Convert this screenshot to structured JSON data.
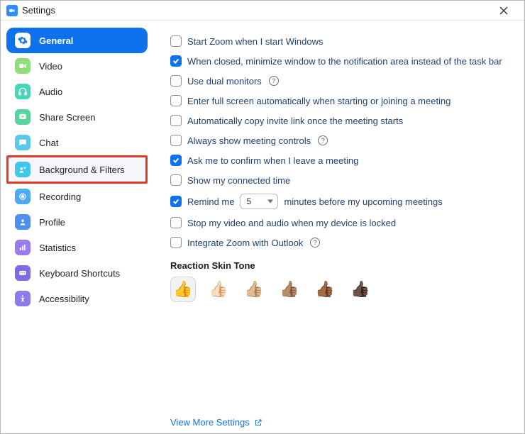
{
  "window": {
    "title": "Settings"
  },
  "sidebar": {
    "items": [
      {
        "id": "general",
        "label": "General",
        "active": true,
        "highlighted": false
      },
      {
        "id": "video",
        "label": "Video",
        "active": false,
        "highlighted": false
      },
      {
        "id": "audio",
        "label": "Audio",
        "active": false,
        "highlighted": false
      },
      {
        "id": "share",
        "label": "Share Screen",
        "active": false,
        "highlighted": false
      },
      {
        "id": "chat",
        "label": "Chat",
        "active": false,
        "highlighted": false
      },
      {
        "id": "bgfilters",
        "label": "Background & Filters",
        "active": false,
        "highlighted": true
      },
      {
        "id": "recording",
        "label": "Recording",
        "active": false,
        "highlighted": false
      },
      {
        "id": "profile",
        "label": "Profile",
        "active": false,
        "highlighted": false
      },
      {
        "id": "stats",
        "label": "Statistics",
        "active": false,
        "highlighted": false
      },
      {
        "id": "keyboard",
        "label": "Keyboard Shortcuts",
        "active": false,
        "highlighted": false
      },
      {
        "id": "access",
        "label": "Accessibility",
        "active": false,
        "highlighted": false
      }
    ]
  },
  "options": {
    "start_windows": {
      "label": "Start Zoom when I start Windows",
      "checked": false
    },
    "minimize_tray": {
      "label": "When closed, minimize window to the notification area instead of the task bar",
      "checked": true
    },
    "dual_monitors": {
      "label": "Use dual monitors",
      "checked": false,
      "help": true
    },
    "full_screen": {
      "label": "Enter full screen automatically when starting or joining a meeting",
      "checked": false
    },
    "copy_invite": {
      "label": "Automatically copy invite link once the meeting starts",
      "checked": false
    },
    "show_controls": {
      "label": "Always show meeting controls",
      "checked": false,
      "help": true
    },
    "confirm_leave": {
      "label": "Ask me to confirm when I leave a meeting",
      "checked": true
    },
    "connected_time": {
      "label": "Show my connected time",
      "checked": false
    },
    "remind": {
      "label_before": "Remind me",
      "value": "5",
      "label_after": "minutes before my upcoming meetings",
      "checked": true
    },
    "stop_locked": {
      "label": "Stop my video and audio when my device is locked",
      "checked": false
    },
    "outlook": {
      "label": "Integrate Zoom with Outlook",
      "checked": false,
      "help": true
    }
  },
  "reaction": {
    "title": "Reaction Skin Tone",
    "tones": [
      "👍",
      "👍🏻",
      "👍🏼",
      "👍🏽",
      "👍🏾",
      "👍🏿"
    ],
    "selected_index": 0
  },
  "footer": {
    "view_more": "View More Settings"
  }
}
